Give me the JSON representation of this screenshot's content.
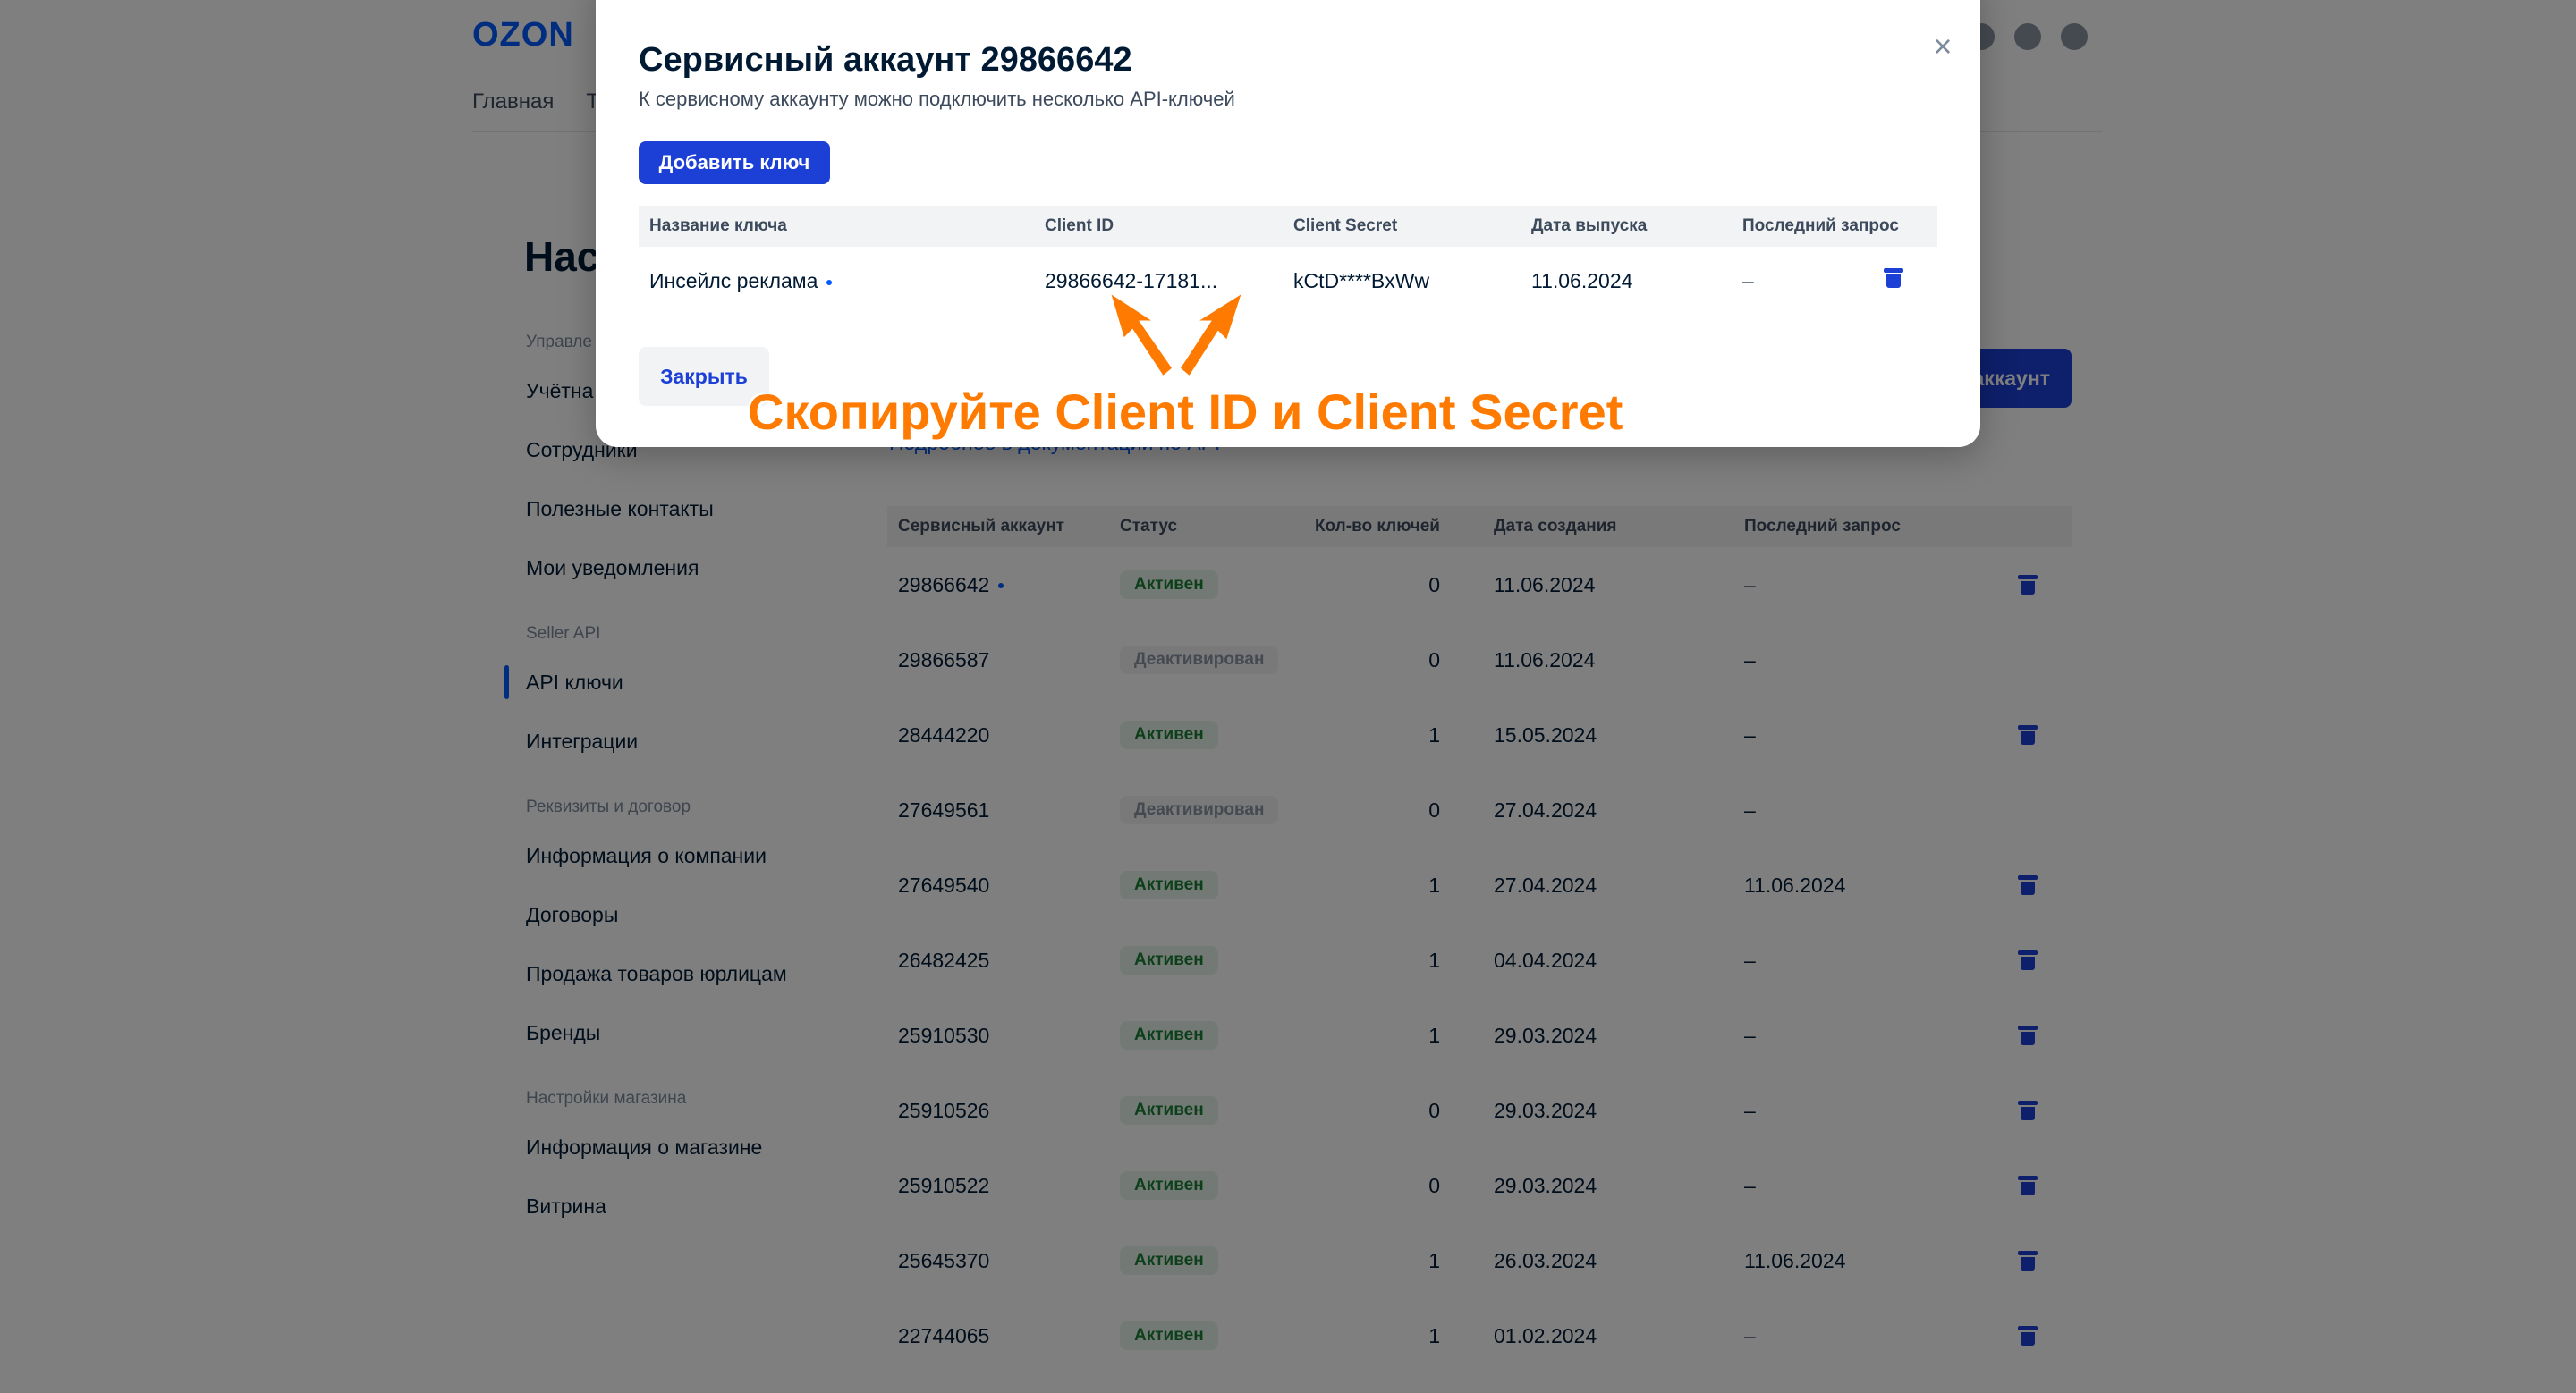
{
  "brand": {
    "logo": "OZON",
    "accent": "#005bff",
    "button": "#1c3fd6",
    "annotation_color": "#ff7a00"
  },
  "topnav": [
    "Главная",
    "Т"
  ],
  "page": {
    "title": "Нас",
    "create_button": "аккаунт",
    "doc_link": "Подробнее в документации по API"
  },
  "sidebar": {
    "groups": [
      {
        "label": "Управле",
        "items": [
          "Учётна",
          "Сотрудники",
          "Полезные контакты",
          "Мои уведомления"
        ]
      },
      {
        "label": "Seller API",
        "items": [
          "API ключи",
          "Интеграции"
        ]
      },
      {
        "label": "Реквизиты и договор",
        "items": [
          "Информация о компании",
          "Договоры",
          "Продажа товаров юрлицам",
          "Бренды"
        ]
      },
      {
        "label": "Настройки магазина",
        "items": [
          "Информация о магазине",
          "Витрина"
        ]
      }
    ],
    "active": "API ключи"
  },
  "accounts_table": {
    "headers": [
      "Сервисный аккаунт",
      "Статус",
      "Кол-во ключей",
      "Дата создания",
      "Последний запрос"
    ],
    "rows": [
      {
        "account": "29866642",
        "status": "Активен",
        "keys": "0",
        "created": "11.06.2024",
        "last": "–"
      },
      {
        "account": "29866587",
        "status": "Деактивирован",
        "keys": "0",
        "created": "11.06.2024",
        "last": "–"
      },
      {
        "account": "28444220",
        "status": "Активен",
        "keys": "1",
        "created": "15.05.2024",
        "last": "–"
      },
      {
        "account": "27649561",
        "status": "Деактивирован",
        "keys": "0",
        "created": "27.04.2024",
        "last": "–"
      },
      {
        "account": "27649540",
        "status": "Активен",
        "keys": "1",
        "created": "27.04.2024",
        "last": "11.06.2024"
      },
      {
        "account": "26482425",
        "status": "Активен",
        "keys": "1",
        "created": "04.04.2024",
        "last": "–"
      },
      {
        "account": "25910530",
        "status": "Активен",
        "keys": "1",
        "created": "29.03.2024",
        "last": "–"
      },
      {
        "account": "25910526",
        "status": "Активен",
        "keys": "0",
        "created": "29.03.2024",
        "last": "–"
      },
      {
        "account": "25910522",
        "status": "Активен",
        "keys": "0",
        "created": "29.03.2024",
        "last": "–"
      },
      {
        "account": "25645370",
        "status": "Активен",
        "keys": "1",
        "created": "26.03.2024",
        "last": "11.06.2024"
      },
      {
        "account": "22744065",
        "status": "Активен",
        "keys": "1",
        "created": "01.02.2024",
        "last": "–"
      }
    ]
  },
  "modal": {
    "title": "Сервисный аккаунт 29866642",
    "subtitle": "К сервисному аккаунту можно подключить несколько API-ключей",
    "add_button": "Добавить ключ",
    "close_button": "Закрыть",
    "close_icon": "×",
    "headers": {
      "name": "Название ключа",
      "client_id": "Client ID",
      "client_secret": "Client Secret",
      "issued": "Дата выпуска",
      "last": "Последний запрос"
    },
    "key_row": {
      "name": "Инсейлс реклама",
      "client_id": "29866642-17181...",
      "client_secret": "kCtD****BxWw",
      "issued": "11.06.2024",
      "last": "–"
    }
  },
  "annotation": "Скопируйте Client ID и Client Secret"
}
